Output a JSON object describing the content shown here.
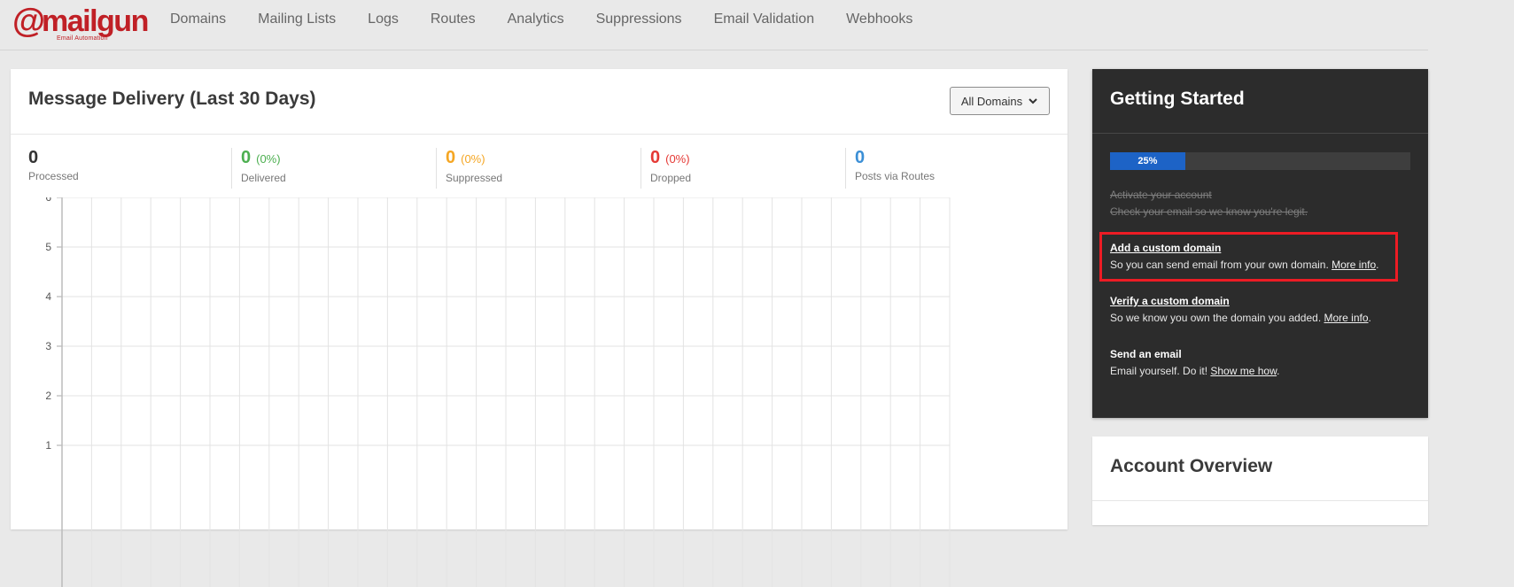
{
  "brand": {
    "logo_word": "mailgun",
    "tagline": "Email Automation",
    "color": "#c02026"
  },
  "nav": {
    "items": [
      {
        "label": "Domains"
      },
      {
        "label": "Mailing Lists"
      },
      {
        "label": "Logs"
      },
      {
        "label": "Routes"
      },
      {
        "label": "Analytics"
      },
      {
        "label": "Suppressions"
      },
      {
        "label": "Email Validation"
      },
      {
        "label": "Webhooks"
      }
    ]
  },
  "delivery": {
    "title": "Message Delivery (Last 30 Days)",
    "domain_filter": "All Domains",
    "stats": [
      {
        "value": "0",
        "percent": "",
        "label": "Processed",
        "color": "#333333"
      },
      {
        "value": "0",
        "percent": "(0%)",
        "label": "Delivered",
        "color": "#4caf50"
      },
      {
        "value": "0",
        "percent": "(0%)",
        "label": "Suppressed",
        "color": "#f5a623"
      },
      {
        "value": "0",
        "percent": "(0%)",
        "label": "Dropped",
        "color": "#e53935"
      },
      {
        "value": "0",
        "percent": "",
        "label": "Posts via Routes",
        "color": "#3b8fd6"
      }
    ]
  },
  "chart_data": {
    "type": "line",
    "title": "",
    "xlabel": "",
    "ylabel": "",
    "ylim": [
      0,
      6
    ],
    "yticks": [
      "6",
      "5",
      "4",
      "3",
      "2",
      "1"
    ],
    "grid": true,
    "series": []
  },
  "getting_started": {
    "title": "Getting Started",
    "progress_label": "25%",
    "progress_value": 0.25,
    "progress_color": "#1d63c6",
    "steps": [
      {
        "title": "Activate your account",
        "desc": "Check your email so we know you're legit.",
        "link": "",
        "done": true
      },
      {
        "title": "Add a custom domain",
        "desc": "So you can send email from your own domain. ",
        "link": "More info",
        "done": false
      },
      {
        "title": "Verify a custom domain",
        "desc": "So we know you own the domain you added. ",
        "link": "More info",
        "done": false
      },
      {
        "title": "Send an email",
        "desc": "Email yourself. Do it! ",
        "link": "Show me how",
        "done": false
      }
    ]
  },
  "account_overview": {
    "title": "Account Overview"
  }
}
